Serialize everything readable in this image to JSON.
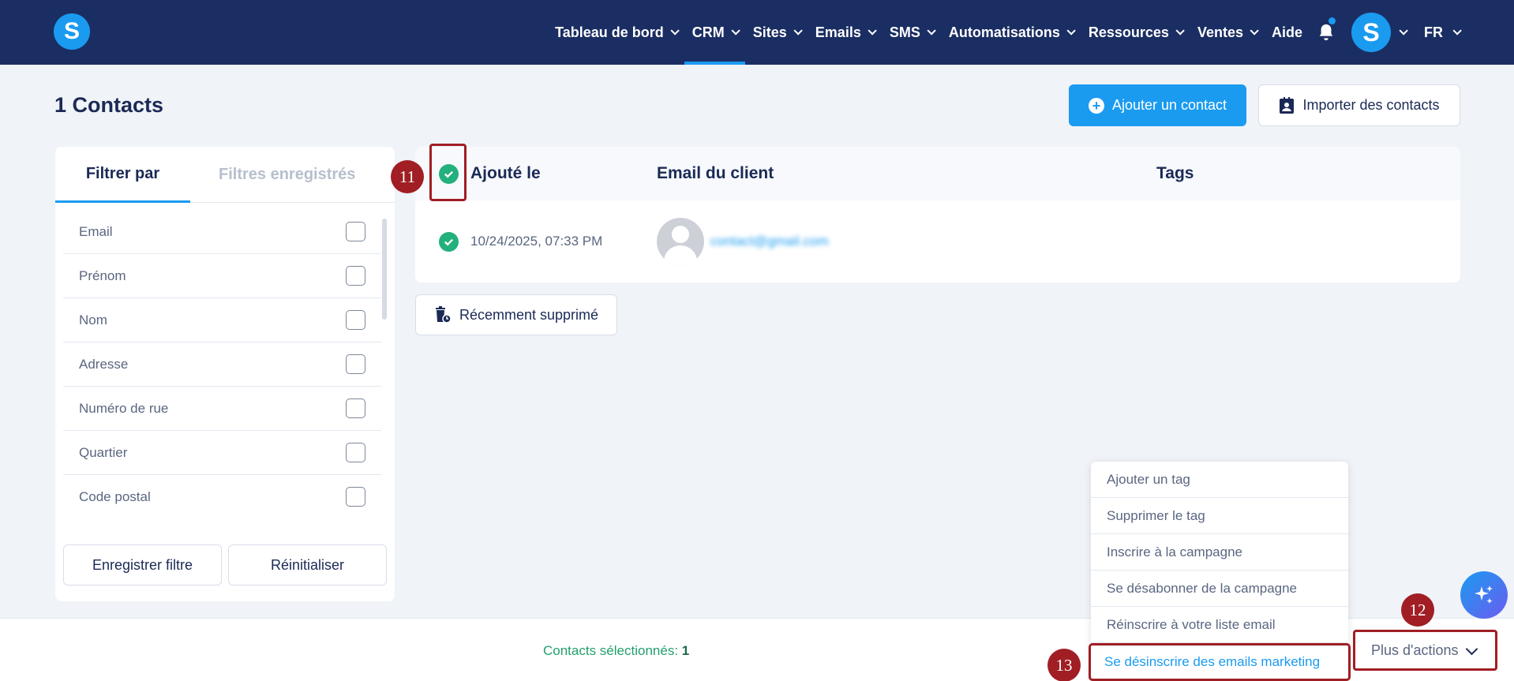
{
  "navbar": {
    "logo_letter": "S",
    "items": [
      {
        "label": "Tableau de bord",
        "has_chevron": true
      },
      {
        "label": "CRM",
        "has_chevron": true,
        "active": true
      },
      {
        "label": "Sites",
        "has_chevron": true
      },
      {
        "label": "Emails",
        "has_chevron": true
      },
      {
        "label": "SMS",
        "has_chevron": true
      },
      {
        "label": "Automatisations",
        "has_chevron": true
      },
      {
        "label": "Ressources",
        "has_chevron": true
      },
      {
        "label": "Ventes",
        "has_chevron": true
      },
      {
        "label": "Aide",
        "has_chevron": false
      }
    ],
    "avatar_letter": "S",
    "language": "FR"
  },
  "header": {
    "title": "1 Contacts",
    "add_contact": "Ajouter un contact",
    "import_contacts": "Importer des contacts"
  },
  "filter": {
    "tab_filter": "Filtrer par",
    "tab_saved": "Filtres enregistrés",
    "fields": [
      "Email",
      "Prénom",
      "Nom",
      "Adresse",
      "Numéro de rue",
      "Quartier",
      "Code postal"
    ],
    "save_filter": "Enregistrer filtre",
    "reset": "Réinitialiser"
  },
  "table": {
    "col_added": "Ajouté le",
    "col_email": "Email du client",
    "col_tags": "Tags",
    "rows": [
      {
        "added": "10/24/2025, 07:33 PM",
        "email": "contact@gmail.com"
      }
    ]
  },
  "recently_deleted": "Récemment supprimé",
  "bottom": {
    "selected_label": "Contacts sélectionnés:",
    "selected_count": "1",
    "more_actions": "Plus d'actions"
  },
  "dropdown": {
    "items": [
      "Ajouter un tag",
      "Supprimer le tag",
      "Inscrire à la campagne",
      "Se désabonner de la campagne",
      "Réinscrire à votre liste email",
      "Se désinscrire des emails marketing"
    ]
  },
  "annotations": {
    "a11": "11",
    "a12": "12",
    "a13": "13"
  },
  "colors": {
    "navy": "#1b2e63",
    "accent": "#1a9bf0",
    "success": "#22b07d",
    "annotation": "#a01e24"
  }
}
